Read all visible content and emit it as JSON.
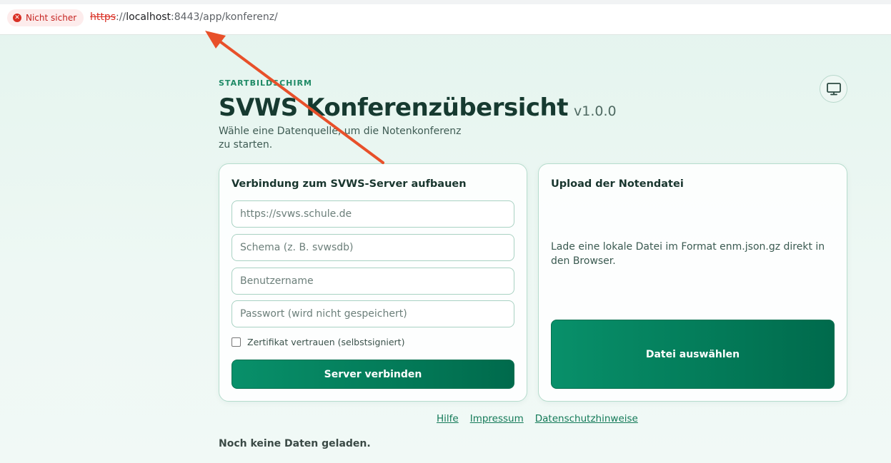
{
  "browser": {
    "security_label": "Nicht sicher",
    "url_scheme": "https",
    "url_separator": "://",
    "url_host": "localhost",
    "url_rest": ":8443/app/konferenz/"
  },
  "header": {
    "eyebrow": "STARTBILDSCHIRM",
    "title": "SVWS Konferenzübersicht",
    "version": "v1.0.0",
    "subtitle": "Wähle eine Datenquelle, um die Notenkonferenz zu starten.",
    "display_toggle_icon": "monitor-icon"
  },
  "server_card": {
    "title": "Verbindung zum SVWS-Server aufbauen",
    "url_placeholder": "https://svws.schule.de",
    "schema_placeholder": "Schema (z. B. svwsdb)",
    "username_placeholder": "Benutzername",
    "password_placeholder": "Passwort (wird nicht gespeichert)",
    "trust_cert_label": "Zertifikat vertrauen (selbstsigniert)",
    "trust_cert_checked": false,
    "connect_label": "Server verbinden"
  },
  "upload_card": {
    "title": "Upload der Notendatei",
    "description": "Lade eine lokale Datei im Format enm.json.gz direkt in den Browser.",
    "choose_file_label": "Datei auswählen"
  },
  "footer": {
    "links": [
      "Hilfe",
      "Impressum",
      "Datenschutzhinweise"
    ]
  },
  "status_text": "Noch keine Daten geladen.",
  "colors": {
    "accent": "#037a58",
    "annotation_arrow": "#e8502a",
    "insecure": "#d93025"
  }
}
